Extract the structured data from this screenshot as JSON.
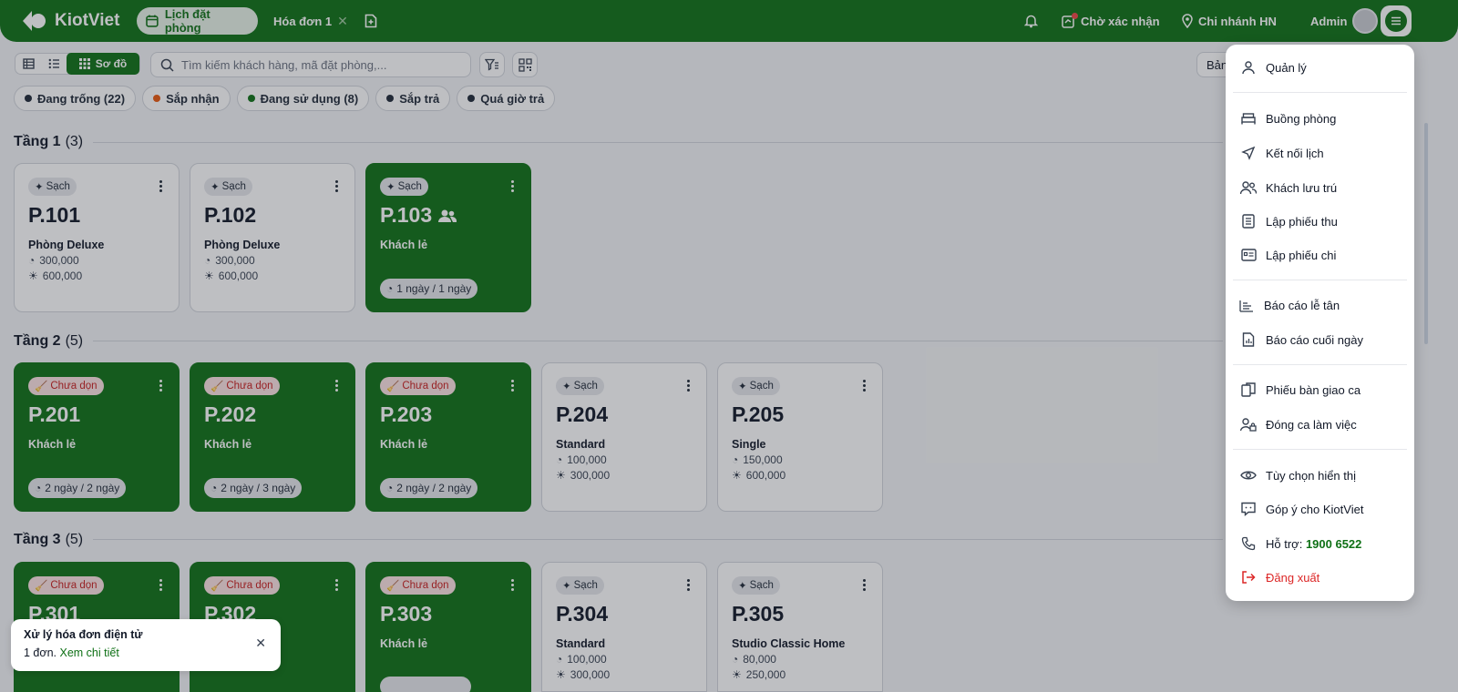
{
  "brand": {
    "name": "KiotViet",
    "color": "#0e7015"
  },
  "topbar": {
    "active_tab": "Lịch đặt phòng",
    "tab2": "Hóa đơn 1",
    "pending": "Chờ xác nhận",
    "branch": "Chi nhánh HN",
    "user": "Admin"
  },
  "toolbar": {
    "view_map_label": "Sơ đồ",
    "search_placeholder": "Tìm kiếm khách hàng, mã đặt phòng,...",
    "right_button": "Bản"
  },
  "filters": [
    {
      "label": "Đang trống (22)",
      "color": "#1f2937"
    },
    {
      "label": "Sắp nhận",
      "color": "#ea580c"
    },
    {
      "label": "Đang sử dụng (8)",
      "color": "#0e7015"
    },
    {
      "label": "Sắp trả",
      "color": "#1f2937"
    },
    {
      "label": "Quá giờ trả",
      "color": "#1f2937"
    }
  ],
  "floors": [
    {
      "name": "Tầng 1",
      "count": "(3)"
    },
    {
      "name": "Tầng 2",
      "count": "(5)"
    },
    {
      "name": "Tầng 3",
      "count": "(5)"
    }
  ],
  "rooms": {
    "r101": {
      "status": "Sạch",
      "no": "P.101",
      "type": "Phòng Deluxe",
      "p1": "300,000",
      "p2": "600,000"
    },
    "r102": {
      "status": "Sạch",
      "no": "P.102",
      "type": "Phòng Deluxe",
      "p1": "300,000",
      "p2": "600,000"
    },
    "r103": {
      "status": "Sạch",
      "no": "P.103",
      "type": "Khách lẻ",
      "stay": "1 ngày / 1 ngày"
    },
    "r201": {
      "status": "Chưa dọn",
      "no": "P.201",
      "type": "Khách lẻ",
      "stay": "2 ngày / 2 ngày"
    },
    "r202": {
      "status": "Chưa dọn",
      "no": "P.202",
      "type": "Khách lẻ",
      "stay": "2 ngày / 3 ngày"
    },
    "r203": {
      "status": "Chưa dọn",
      "no": "P.203",
      "type": "Khách lẻ",
      "stay": "2 ngày / 2 ngày"
    },
    "r204": {
      "status": "Sạch",
      "no": "P.204",
      "type": "Standard",
      "p1": "100,000",
      "p2": "300,000"
    },
    "r205": {
      "status": "Sạch",
      "no": "P.205",
      "type": "Single",
      "p1": "150,000",
      "p2": "600,000"
    },
    "r301": {
      "status": "Chưa dọn",
      "no": "P.301"
    },
    "r302": {
      "status": "Chưa dọn",
      "no": "P.302"
    },
    "r303": {
      "status": "Chưa dọn",
      "no": "P.303",
      "type": "Khách lẻ"
    },
    "r304": {
      "status": "Sạch",
      "no": "P.304",
      "type": "Standard",
      "p1": "100,000",
      "p2": "300,000"
    },
    "r305": {
      "status": "Sạch",
      "no": "P.305",
      "type": "Studio Classic Home",
      "p1": "80,000",
      "p2": "250,000"
    }
  },
  "toast": {
    "title": "Xử lý hóa đơn điện tử",
    "body": "1 đơn.",
    "link": "Xem chi tiết"
  },
  "menu": {
    "manage": "Quản lý",
    "rooms": "Buồng phòng",
    "calendar": "Kết nối lịch",
    "guests": "Khách lưu trú",
    "receipt": "Lập phiếu thu",
    "payment": "Lập phiếu chi",
    "front_report": "Báo cáo lễ tân",
    "eod_report": "Báo cáo cuối ngày",
    "handover": "Phiếu bàn giao ca",
    "close_shift": "Đóng ca làm việc",
    "display": "Tùy chọn hiển thị",
    "feedback": "Góp ý cho KiotViet",
    "support": "Hỗ trợ:",
    "support_phone": "1900 6522",
    "logout": "Đăng xuất"
  }
}
